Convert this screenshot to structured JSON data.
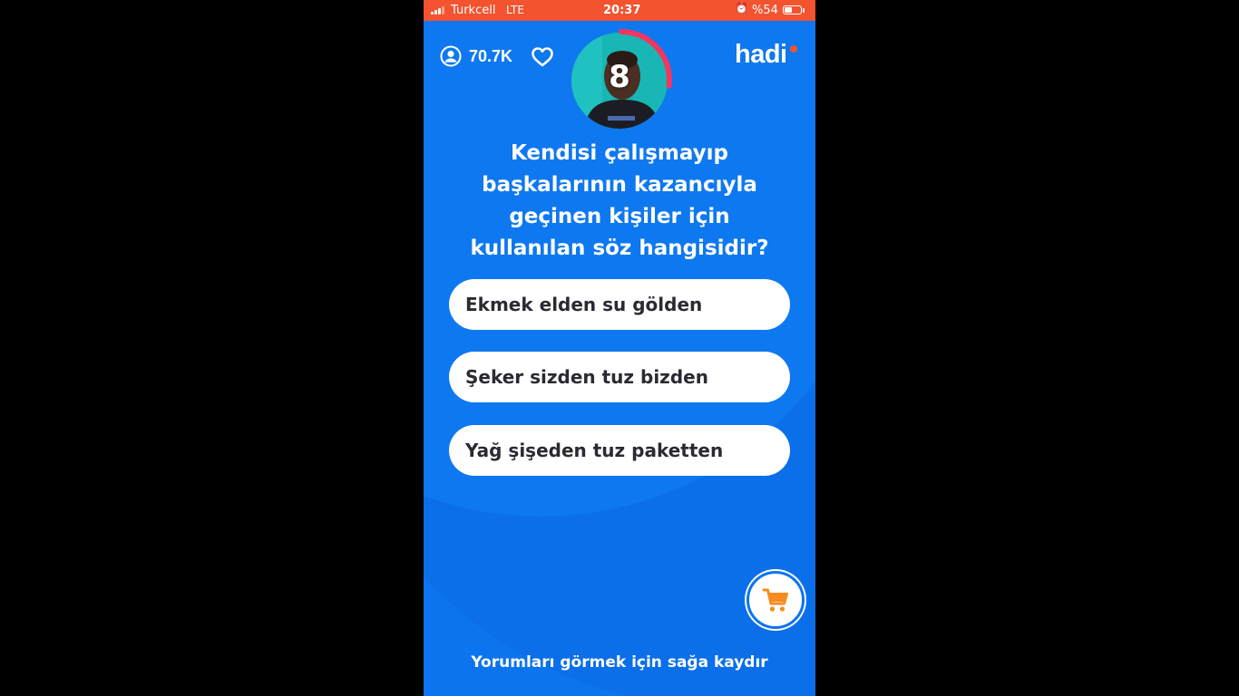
{
  "status_bar": {
    "carrier": "Turkcell",
    "network": "LTE",
    "time": "20:37",
    "alarm_icon": "alarm-clock-icon",
    "battery_text": "%54",
    "battery_level": 0.54,
    "color": "#f3532f"
  },
  "header": {
    "viewer_count": "70.7K",
    "viewer_icon": "user-icon",
    "like_icon": "heart-icon",
    "logo_text": "hadi"
  },
  "timer": {
    "seconds_left": "8",
    "remaining_fraction": 0.27,
    "ring_color": "#f4365f"
  },
  "question": {
    "text": "Kendisi çalışmayıp başkalarının kazancıyla geçinen kişiler için kullanılan söz hangisidir?"
  },
  "answers": [
    {
      "label": "Ekmek elden su gölden"
    },
    {
      "label": "Şeker sizden tuz bizden"
    },
    {
      "label": "Yağ şişeden tuz paketten"
    }
  ],
  "shop": {
    "icon": "shopping-cart-icon",
    "icon_color": "#f78b1f"
  },
  "footer": {
    "hint": "Yorumları görmek için sağa kaydır"
  },
  "colors": {
    "background": "#0c74ee",
    "accent": "#f3532f"
  }
}
